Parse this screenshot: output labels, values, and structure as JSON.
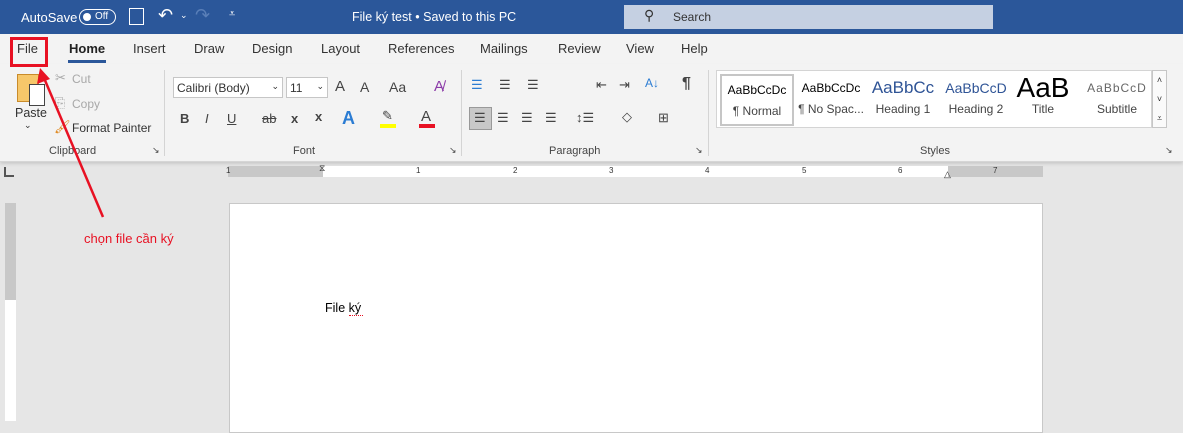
{
  "titlebar": {
    "autosave_label": "AutoSave",
    "autosave_state": "Off",
    "doc_title": "File ký test",
    "save_status": "Saved to this PC",
    "separator": "•",
    "search_placeholder": "Search"
  },
  "tabs": [
    "File",
    "Home",
    "Insert",
    "Draw",
    "Design",
    "Layout",
    "References",
    "Mailings",
    "Review",
    "View",
    "Help"
  ],
  "active_tab": "Home",
  "clipboard": {
    "paste": "Paste",
    "cut": "Cut",
    "copy": "Copy",
    "format_painter": "Format Painter",
    "group": "Clipboard"
  },
  "font": {
    "name": "Calibri (Body)",
    "size": "11",
    "group": "Font",
    "grow": "A",
    "shrink": "A",
    "case": "Aa",
    "bold": "B",
    "italic": "I",
    "underline": "U",
    "strike": "ab",
    "sub": "x",
    "sup": "x",
    "effects": "A",
    "highlight_color": "#ffff00",
    "font_color": "#e81123",
    "font_color_glyph": "A"
  },
  "paragraph": {
    "group": "Paragraph",
    "pilcrow": "¶"
  },
  "styles": {
    "group": "Styles",
    "items": [
      {
        "preview": "AaBbCcDc",
        "name": "¶ Normal"
      },
      {
        "preview": "AaBbCcDc",
        "name": "¶ No Spac..."
      },
      {
        "preview": "AaBbCc",
        "name": "Heading 1"
      },
      {
        "preview": "AaBbCcD",
        "name": "Heading 2"
      },
      {
        "preview": "AaB",
        "name": "Title"
      },
      {
        "preview": "AaBbCcD",
        "name": "Subtitle"
      }
    ]
  },
  "ruler": {
    "numbers": [
      "1",
      "1",
      "2",
      "3",
      "4",
      "5",
      "6",
      "7"
    ]
  },
  "document": {
    "text": "File ký"
  },
  "annotation": {
    "text": "chọn file cần ký",
    "color": "#e81123"
  },
  "colors": {
    "brand": "#2b579a",
    "accent": "#2b579a"
  }
}
